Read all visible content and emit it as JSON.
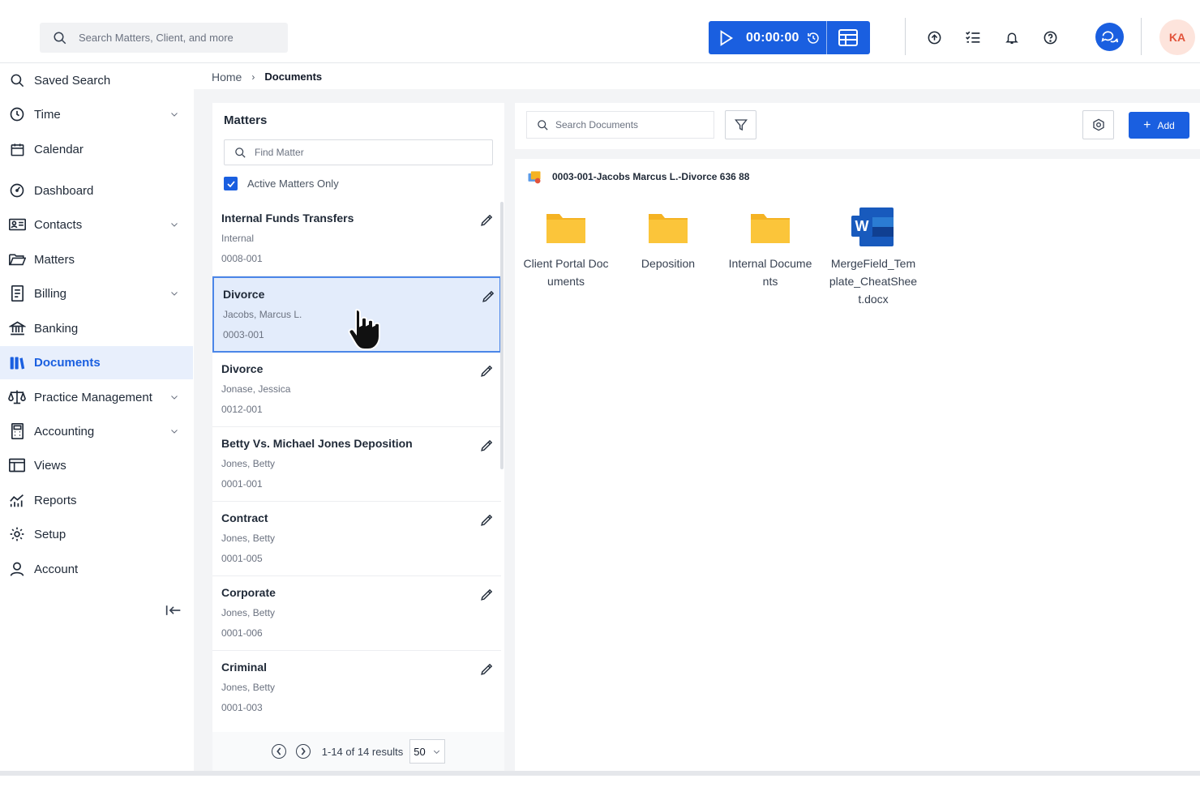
{
  "topbar": {
    "search_placeholder": "Search Matters, Client, and more",
    "timer": "00:00:00",
    "avatar_initials": "KA"
  },
  "sidebar": {
    "items": [
      {
        "label": "Saved Search",
        "icon": "search-icon",
        "expandable": false
      },
      {
        "label": "Time",
        "icon": "clock-icon",
        "expandable": true
      },
      {
        "label": "Calendar",
        "icon": "calendar-icon",
        "expandable": false
      },
      {
        "label": "Dashboard",
        "icon": "gauge-icon",
        "expandable": false
      },
      {
        "label": "Contacts",
        "icon": "contacts-icon",
        "expandable": true
      },
      {
        "label": "Matters",
        "icon": "folder-open-icon",
        "expandable": false
      },
      {
        "label": "Billing",
        "icon": "billing-icon",
        "expandable": true
      },
      {
        "label": "Banking",
        "icon": "bank-icon",
        "expandable": false
      },
      {
        "label": "Documents",
        "icon": "documents-icon",
        "expandable": false,
        "active": true
      },
      {
        "label": "Practice Management",
        "icon": "scales-icon",
        "expandable": true
      },
      {
        "label": "Accounting",
        "icon": "calculator-icon",
        "expandable": true
      },
      {
        "label": "Views",
        "icon": "views-icon",
        "expandable": false
      },
      {
        "label": "Reports",
        "icon": "reports-icon",
        "expandable": false
      },
      {
        "label": "Setup",
        "icon": "gear-icon",
        "expandable": false
      },
      {
        "label": "Account",
        "icon": "user-icon",
        "expandable": false
      }
    ]
  },
  "breadcrumb": {
    "home": "Home",
    "current": "Documents"
  },
  "matters_panel": {
    "title": "Matters",
    "find_placeholder": "Find Matter",
    "active_only_label": "Active Matters Only",
    "active_only_checked": true,
    "items": [
      {
        "name": "Internal Funds Transfers",
        "client": "Internal",
        "code": "0008-001"
      },
      {
        "name": "Divorce",
        "client": "Jacobs, Marcus L.",
        "code": "0003-001",
        "selected": true
      },
      {
        "name": "Divorce",
        "client": "Jonase, Jessica",
        "code": "0012-001"
      },
      {
        "name": "Betty Vs. Michael Jones Deposition",
        "client": "Jones, Betty",
        "code": "0001-001"
      },
      {
        "name": "Contract",
        "client": "Jones, Betty",
        "code": "0001-005"
      },
      {
        "name": "Corporate",
        "client": "Jones, Betty",
        "code": "0001-006"
      },
      {
        "name": "Criminal",
        "client": "Jones, Betty",
        "code": "0001-003"
      }
    ],
    "pager": {
      "info": "1-14 of 14 results",
      "page_size": "50"
    }
  },
  "documents": {
    "search_placeholder": "Search Documents",
    "add_label": "Add",
    "header": "0003-001-Jacobs Marcus L.-Divorce 636 88",
    "items": [
      {
        "label": "Client Portal Documents",
        "type": "folder"
      },
      {
        "label": "Deposition",
        "type": "folder"
      },
      {
        "label": "Internal Documents",
        "type": "folder"
      },
      {
        "label": "MergeField_Template_CheatSheet.docx",
        "type": "word"
      }
    ]
  },
  "colors": {
    "accent": "#1a5fe0",
    "selected_bg": "#e3ecfb",
    "folder": "#fbbf24",
    "avatar_bg": "#fde4dc"
  }
}
